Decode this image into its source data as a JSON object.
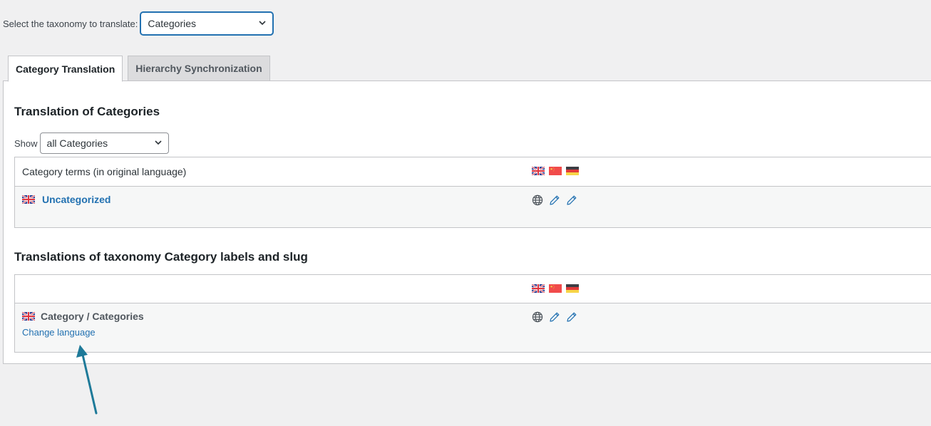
{
  "taxonomy_selector": {
    "label": "Select the taxonomy to translate:",
    "selected": "Categories"
  },
  "tabs": [
    {
      "label": "Category Translation",
      "active": true
    },
    {
      "label": "Hierarchy Synchronization",
      "active": false
    }
  ],
  "section1": {
    "title": "Translation of Categories",
    "filter": {
      "label": "Show",
      "selected": "all Categories"
    },
    "table": {
      "header": "Category terms (in original language)",
      "languages": [
        "uk-flag",
        "china-flag",
        "germany-flag"
      ],
      "rows": [
        {
          "flag": "uk-flag",
          "term": "Uncategorized",
          "actions": [
            "globe-icon",
            "pencil-icon",
            "pencil-icon"
          ]
        }
      ]
    }
  },
  "section2": {
    "title": "Translations of taxonomy Category labels and slug",
    "table": {
      "header": "",
      "languages": [
        "uk-flag",
        "china-flag",
        "germany-flag"
      ],
      "rows": [
        {
          "flag": "uk-flag",
          "term": "Category / Categories",
          "change_language": "Change language",
          "actions": [
            "globe-icon",
            "pencil-icon",
            "pencil-icon"
          ]
        }
      ]
    }
  },
  "annotation": {
    "type": "arrow",
    "color": "#1e7a99",
    "points_to": "Change language"
  },
  "colors": {
    "link": "#2271b1",
    "focus": "#2271b1",
    "arrow": "#1e7a99"
  }
}
